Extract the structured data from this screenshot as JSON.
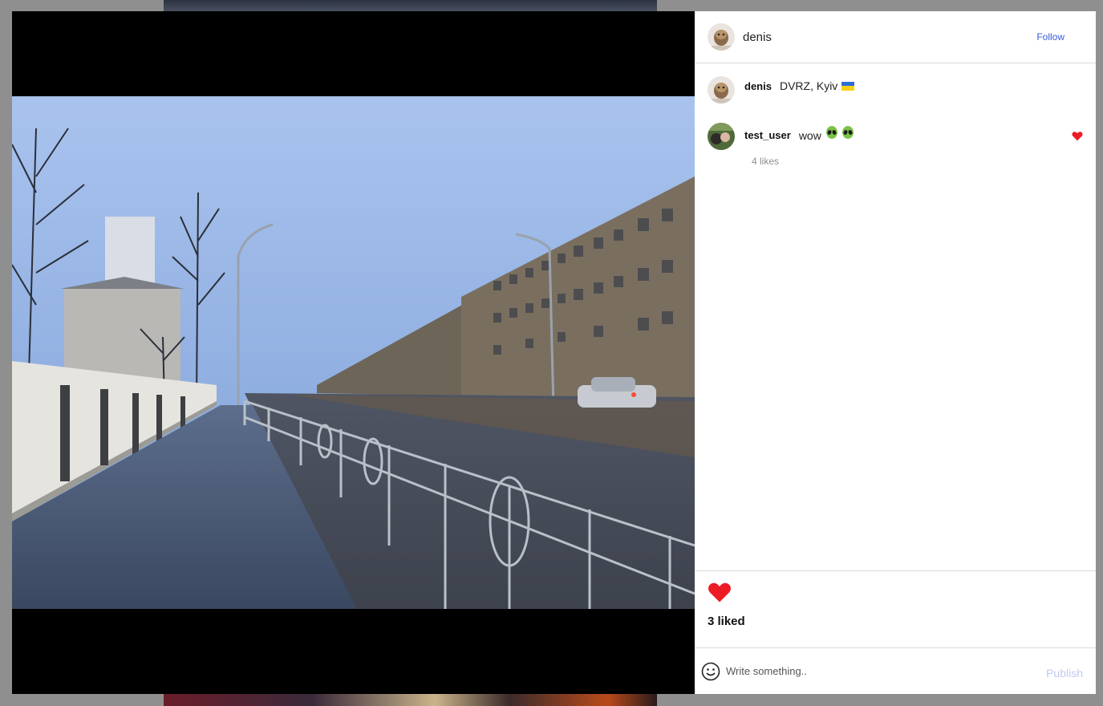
{
  "post": {
    "author": "denis",
    "follow_label": "Follow",
    "caption_user": "denis",
    "caption_text": "DVRZ, Kyiv",
    "caption_flag": "ukraine-flag-icon",
    "liked_count": "3 liked",
    "like_color": "#ed1c24"
  },
  "comments": [
    {
      "user": "test_user",
      "text": "wow",
      "emojis": [
        "alien-icon",
        "alien-icon"
      ],
      "likes": "4 likes",
      "liked": true
    }
  ],
  "composer": {
    "placeholder": "Write something..",
    "publish_label": "Publish"
  }
}
